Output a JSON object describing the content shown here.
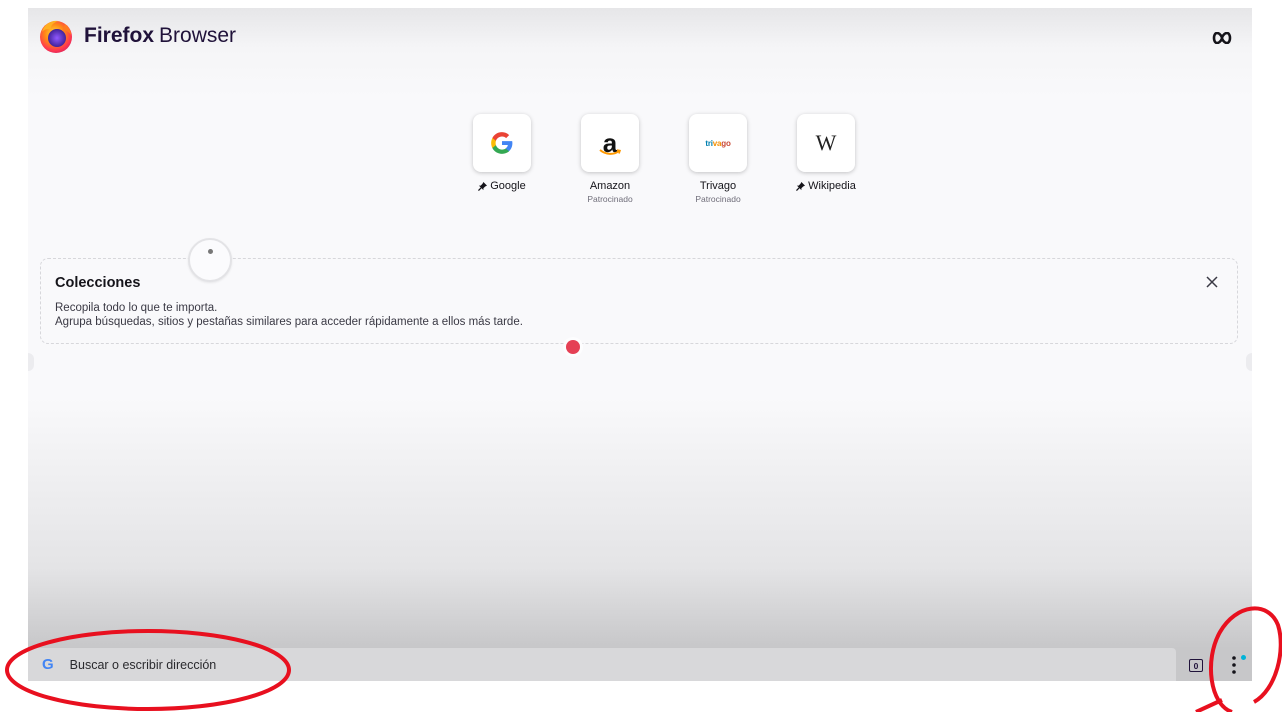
{
  "header": {
    "brand_bold": "Firefox",
    "brand_rest": "Browser",
    "private_mode_icon": "infinity-mask-icon"
  },
  "top_sites": [
    {
      "name": "Google",
      "pinned": true,
      "sub": "",
      "icon": "google-g-icon"
    },
    {
      "name": "Amazon",
      "pinned": false,
      "sub": "Patrocinado",
      "icon": "amazon-a-icon"
    },
    {
      "name": "Trivago",
      "pinned": false,
      "sub": "Patrocinado",
      "icon": "trivago-logo-icon",
      "logo_text": "trivago"
    },
    {
      "name": "Wikipedia",
      "pinned": true,
      "sub": "",
      "icon": "wikipedia-w-icon"
    }
  ],
  "collections": {
    "title": "Colecciones",
    "line1": "Recopila todo lo que te importa.",
    "line2": "Agrupa búsquedas, sitios y pestañas similares para acceder rápidamente a ellos más tarde."
  },
  "toolbar": {
    "search_engine_letter": "G",
    "address_placeholder": "Buscar o escribir dirección",
    "tab_count": "0",
    "menu_icon": "three-dots-icon"
  },
  "colors": {
    "annotation_red": "#e8101f",
    "firefox_purple": "#20123a",
    "tooltip_red_dot": "#e54055",
    "google_blue": "#4285f4"
  }
}
